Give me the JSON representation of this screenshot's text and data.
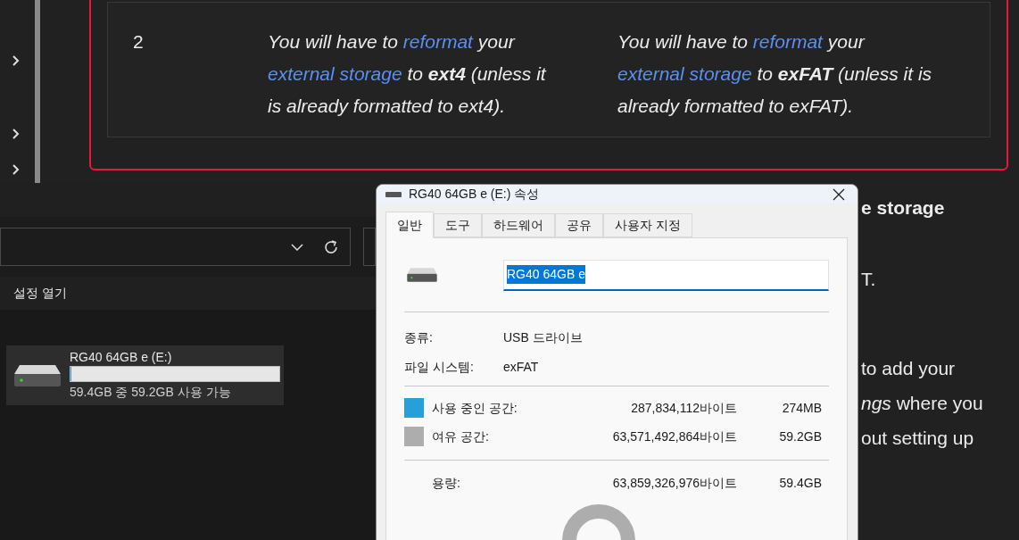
{
  "sidebar": {
    "items": [
      {
        "expanded": false
      },
      {
        "expanded": false
      },
      {
        "expanded": false
      }
    ]
  },
  "table": {
    "rows": [
      {
        "cells": [
          {
            "kind": "number",
            "text": "2"
          },
          {
            "kind": "rich",
            "parts": [
              {
                "kind": "text",
                "text": "You will have to "
              },
              {
                "kind": "link",
                "text": "reformat"
              },
              {
                "kind": "text",
                "text": " your "
              },
              {
                "kind": "link",
                "text": "external storage"
              },
              {
                "kind": "text",
                "text": " to "
              },
              {
                "kind": "bold",
                "text": "ext4"
              },
              {
                "kind": "text",
                "text": " (unless it is already formatted to ext4)."
              }
            ]
          },
          {
            "kind": "rich",
            "parts": [
              {
                "kind": "text",
                "text": "You will have to "
              },
              {
                "kind": "link",
                "text": "reformat"
              },
              {
                "kind": "text",
                "text": " your "
              },
              {
                "kind": "link",
                "text": "external storage"
              },
              {
                "kind": "text",
                "text": " to "
              },
              {
                "kind": "bold",
                "text": "exFAT"
              },
              {
                "kind": "text",
                "text": " (unless it is already formatted to exFAT)."
              }
            ]
          }
        ]
      }
    ]
  },
  "article_fragments": [
    {
      "kind": "heading",
      "lines": [
        "e storage"
      ]
    },
    {
      "kind": "text",
      "lines": [
        "T."
      ]
    },
    {
      "kind": "text",
      "lines": [
        "to add your",
        "*ngs* where you",
        "out setting up"
      ]
    }
  ],
  "explorer": {
    "commands": [
      {
        "label": "설정 열기"
      }
    ],
    "drives": [
      {
        "name": "RG40 64GB e (E:)",
        "level": 0.0045,
        "free_text": "59.4GB 중 59.2GB 사용 가능",
        "selected": true
      }
    ]
  },
  "dialog": {
    "title": "RG40 64GB e (E:) 속성",
    "tabs": [
      {
        "label": "일반",
        "selected": true
      },
      {
        "label": "도구",
        "selected": false
      },
      {
        "label": "하드웨어",
        "selected": false
      },
      {
        "label": "공유",
        "selected": false
      },
      {
        "label": "사용자 지정",
        "selected": false
      }
    ],
    "name_field": {
      "value": "RG40 64GB e",
      "text_selected": true
    },
    "properties": [
      {
        "label": "종류:",
        "value": "USB 드라이브"
      },
      {
        "label": "파일 시스템:",
        "value": "exFAT"
      }
    ],
    "space": [
      {
        "label": "사용 중인 공간:",
        "bytes": "287,834,112바이트",
        "size": "274MB",
        "color": "#26a0da"
      },
      {
        "label": "여유 공간:",
        "bytes": "63,571,492,864바이트",
        "size": "59.2GB",
        "color": "#adadad"
      }
    ],
    "capacity": {
      "label": "용량:",
      "bytes": "63,859,326,976바이트",
      "size": "59.4GB"
    }
  }
}
